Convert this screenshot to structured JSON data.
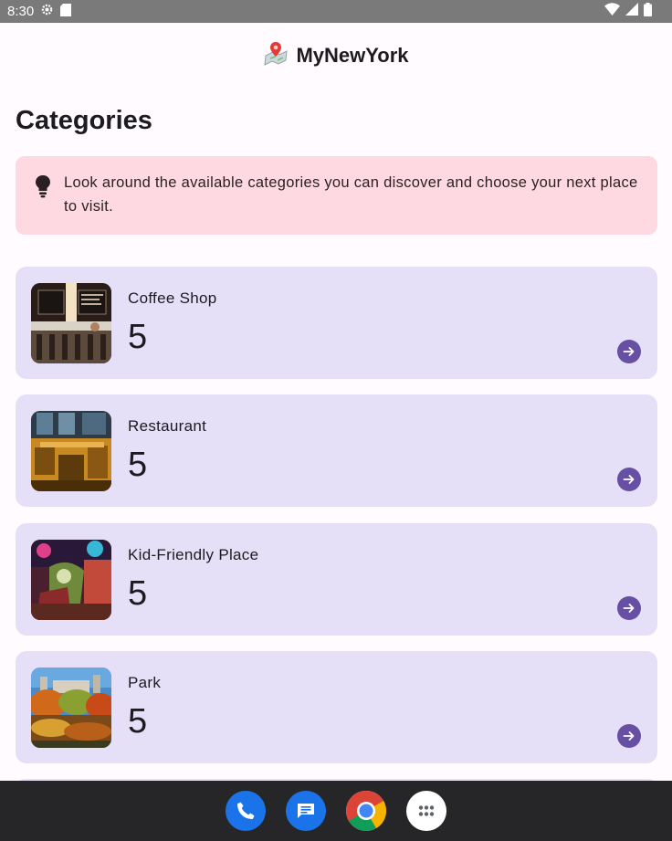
{
  "status_bar": {
    "time": "8:30"
  },
  "app_bar": {
    "title": "MyNewYork"
  },
  "page": {
    "title": "Categories"
  },
  "info_card": {
    "text": "Look around the available categories you can discover and choose your next place to visit."
  },
  "categories": [
    {
      "name": "Coffee Shop",
      "count": "5"
    },
    {
      "name": "Restaurant",
      "count": "5"
    },
    {
      "name": "Kid-Friendly Place",
      "count": "5"
    },
    {
      "name": "Park",
      "count": "5"
    }
  ],
  "dock": {
    "icons": [
      "phone-icon",
      "messages-icon",
      "chrome-icon",
      "app-drawer-icon"
    ]
  },
  "colors": {
    "background": "#fffbfe",
    "info_card": "#ffd9e2",
    "category_card": "#e5e0f7",
    "accent": "#6750a4",
    "nav_bar": "#262628"
  }
}
